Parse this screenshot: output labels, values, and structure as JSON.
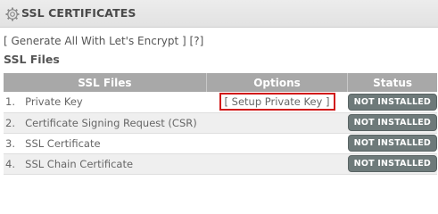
{
  "header": {
    "title": "SSL CERTIFICATES",
    "icon": "gear-icon"
  },
  "actions": {
    "open_bracket": "[ ",
    "generate_label": "Generate All With Let's Encrypt",
    "close_bracket": " ]",
    "help_label": "[?]"
  },
  "section_title": "SSL Files",
  "table": {
    "columns": [
      "SSL Files",
      "Options",
      "Status"
    ],
    "rows": [
      {
        "num": "1.",
        "name": "Private Key",
        "option": "[ Setup Private Key ]",
        "status": "NOT INSTALLED"
      },
      {
        "num": "2.",
        "name": "Certificate Signing Request (CSR)",
        "option": "",
        "status": "NOT INSTALLED"
      },
      {
        "num": "3.",
        "name": "SSL Certificate",
        "option": "",
        "status": "NOT INSTALLED"
      },
      {
        "num": "4.",
        "name": "SSL Chain Certificate",
        "option": "",
        "status": "NOT INSTALLED"
      }
    ]
  },
  "colors": {
    "header_bg": "#e6e6e6",
    "table_header_bg": "#a8a8a8",
    "highlight_border": "#d11a1a",
    "badge_bg": "#6e7a7a"
  }
}
